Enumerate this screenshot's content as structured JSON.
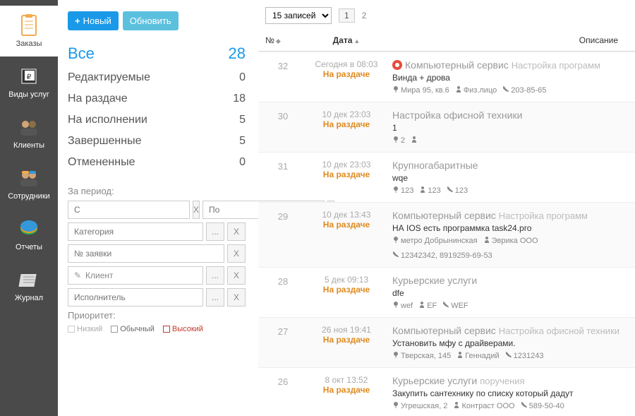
{
  "nav": [
    {
      "label": "Заказы",
      "icon": "clipboard",
      "active": true
    },
    {
      "label": "Виды услуг",
      "icon": "tag"
    },
    {
      "label": "Клиенты",
      "icon": "people"
    },
    {
      "label": "Сотрудники",
      "icon": "workers"
    },
    {
      "label": "Отчеты",
      "icon": "chart"
    },
    {
      "label": "Журнал",
      "icon": "journal"
    }
  ],
  "buttons": {
    "new": "Новый",
    "refresh": "Обновить"
  },
  "categories": [
    {
      "label": "Все",
      "count": "28",
      "sel": true
    },
    {
      "label": "Редактируемые",
      "count": "0"
    },
    {
      "label": "На раздаче",
      "count": "18"
    },
    {
      "label": "На исполнении",
      "count": "5"
    },
    {
      "label": "Завершенные",
      "count": "5"
    },
    {
      "label": "Отмененные",
      "count": "0"
    }
  ],
  "filters": {
    "period_label": "За период:",
    "from": "С",
    "to": "По",
    "category": "Категория",
    "ticket": "№ заявки",
    "client": "Клиент",
    "executor": "Исполнитель",
    "priority_label": "Приоритет:",
    "priority": {
      "low": "Низкий",
      "normal": "Обычный",
      "high": "Высокий"
    }
  },
  "pager": {
    "size": "15 записей",
    "pages": [
      "1",
      "2"
    ],
    "current": 0
  },
  "thead": {
    "num": "№",
    "date": "Дата",
    "desc": "Описание"
  },
  "rows": [
    {
      "num": "32",
      "date": "Сегодня в 08:03",
      "status": "На раздаче",
      "fire": true,
      "title": "Компьютерный сервис",
      "sub": "Настройка программ",
      "desc": "Винда + дрова",
      "meta": [
        {
          "icon": "pin",
          "text": "Мира 95, кв.6"
        },
        {
          "icon": "user",
          "text": "Физ.лицо"
        },
        {
          "icon": "phone",
          "text": "203-85-65"
        }
      ]
    },
    {
      "num": "30",
      "date": "10 дек 23:03",
      "status": "На раздаче",
      "title": "Настройка офисной техники",
      "desc": "1",
      "meta": [
        {
          "icon": "pin",
          "text": "2"
        },
        {
          "icon": "user",
          "text": ""
        }
      ]
    },
    {
      "num": "31",
      "date": "10 дек 23:03",
      "status": "На раздаче",
      "title": "Крупногабаритные",
      "desc": "wqe",
      "meta": [
        {
          "icon": "pin",
          "text": "123"
        },
        {
          "icon": "user",
          "text": "123"
        },
        {
          "icon": "phone",
          "text": "123"
        }
      ]
    },
    {
      "num": "29",
      "date": "10 дек 13:43",
      "status": "На раздаче",
      "title": "Компьютерный сервис",
      "sub": "Настройка программ",
      "desc": "НА IOS есть программка task24.pro",
      "meta": [
        {
          "icon": "pin",
          "text": "метро Добрынинская"
        },
        {
          "icon": "user",
          "text": "Эврика ООО"
        },
        {
          "icon": "phone",
          "text": "12342342, 8919259-69-53"
        }
      ]
    },
    {
      "num": "28",
      "date": "5 дек 09:13",
      "status": "На раздаче",
      "title": "Курьерские услуги",
      "desc": "dfe",
      "meta": [
        {
          "icon": "pin",
          "text": "wef"
        },
        {
          "icon": "user",
          "text": "EF"
        },
        {
          "icon": "phone",
          "text": "WEF"
        }
      ]
    },
    {
      "num": "27",
      "date": "26 ноя 19:41",
      "status": "На раздаче",
      "title": "Компьютерный сервис",
      "sub": "Настройка офисной техники",
      "desc": "Установить мфу с драйверами.",
      "meta": [
        {
          "icon": "pin",
          "text": "Тверская, 145"
        },
        {
          "icon": "user",
          "text": "Геннадий"
        },
        {
          "icon": "phone",
          "text": "1231243"
        }
      ]
    },
    {
      "num": "26",
      "date": "8 окт 13:52",
      "status": "На раздаче",
      "title": "Курьерские услуги",
      "sub": "поручения",
      "desc": "Закупить сантехнику по списку который дадут",
      "meta": [
        {
          "icon": "pin",
          "text": "Угрешская, 2"
        },
        {
          "icon": "user",
          "text": "Контраст ООО"
        },
        {
          "icon": "phone",
          "text": "589-50-40"
        }
      ]
    }
  ]
}
